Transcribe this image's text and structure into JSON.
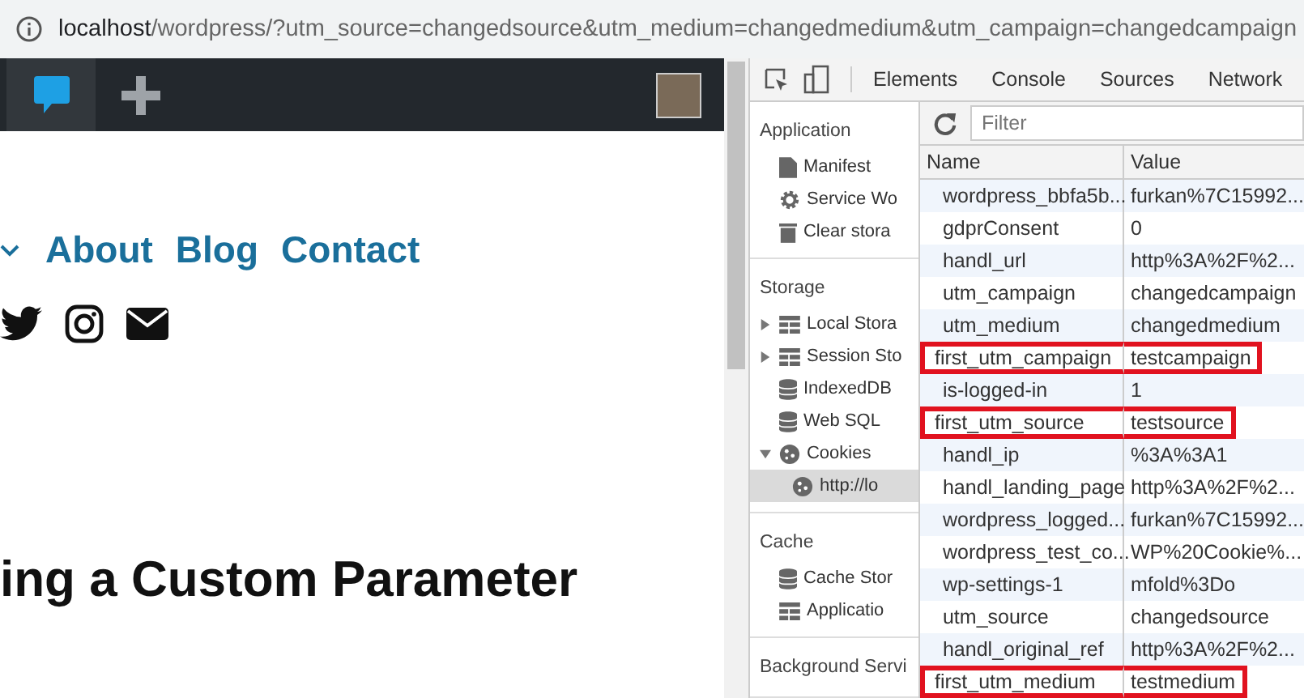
{
  "address_bar": {
    "host": "localhost",
    "path": "/wordpress/?utm_source=changedsource&utm_medium=changedmedium&utm_campaign=changedcampaign"
  },
  "page": {
    "nav": [
      "About",
      "Blog",
      "Contact"
    ],
    "heading": "ing a Custom Parameter"
  },
  "devtools": {
    "tabs": [
      "Elements",
      "Console",
      "Sources",
      "Network"
    ],
    "filter": {
      "placeholder": "Filter"
    },
    "sidebar": [
      {
        "title": "Application",
        "items": [
          {
            "label": "Manifest",
            "selected": false
          },
          {
            "label": "Service Wo",
            "selected": false
          },
          {
            "label": "Clear stora",
            "selected": false
          }
        ]
      },
      {
        "title": "Storage",
        "items": [
          {
            "label": "Local Stora",
            "expanded": false,
            "selected": false
          },
          {
            "label": "Session Sto",
            "expanded": false,
            "selected": false
          },
          {
            "label": "IndexedDB",
            "selected": false
          },
          {
            "label": "Web SQL",
            "selected": false
          },
          {
            "label": "Cookies",
            "expanded": true,
            "selected": false,
            "children": [
              {
                "label": "http://lo",
                "selected": true
              }
            ]
          }
        ]
      },
      {
        "title": "Cache",
        "items": [
          {
            "label": "Cache Stor",
            "selected": false
          },
          {
            "label": "Applicatio",
            "selected": false
          }
        ]
      },
      {
        "title": "Background Servi"
      }
    ],
    "table": {
      "columns": [
        "Name",
        "Value"
      ],
      "rows": [
        {
          "name": "wordpress_bbfa5b...",
          "value": "furkan%7C15992...",
          "highlighted": false
        },
        {
          "name": "gdprConsent",
          "value": "0",
          "highlighted": false
        },
        {
          "name": "handl_url",
          "value": "http%3A%2F%2...",
          "highlighted": false
        },
        {
          "name": "utm_campaign",
          "value": "changedcampaign",
          "highlighted": false
        },
        {
          "name": "utm_medium",
          "value": "changedmedium",
          "highlighted": false
        },
        {
          "name": "first_utm_campaign",
          "value": "testcampaign",
          "highlighted": true
        },
        {
          "name": "is-logged-in",
          "value": "1",
          "highlighted": false
        },
        {
          "name": "first_utm_source",
          "value": "testsource",
          "highlighted": true
        },
        {
          "name": "handl_ip",
          "value": "%3A%3A1",
          "highlighted": false
        },
        {
          "name": "handl_landing_page",
          "value": "http%3A%2F%2...",
          "highlighted": false
        },
        {
          "name": "wordpress_logged...",
          "value": "furkan%7C15992...",
          "highlighted": false
        },
        {
          "name": "wordpress_test_co...",
          "value": "WP%20Cookie%...",
          "highlighted": false
        },
        {
          "name": "wp-settings-1",
          "value": "mfold%3Do",
          "highlighted": false
        },
        {
          "name": "utm_source",
          "value": "changedsource",
          "highlighted": false
        },
        {
          "name": "handl_original_ref",
          "value": "http%3A%2F%2...",
          "highlighted": false
        },
        {
          "name": "first_utm_medium",
          "value": "testmedium",
          "highlighted": true
        }
      ]
    }
  }
}
